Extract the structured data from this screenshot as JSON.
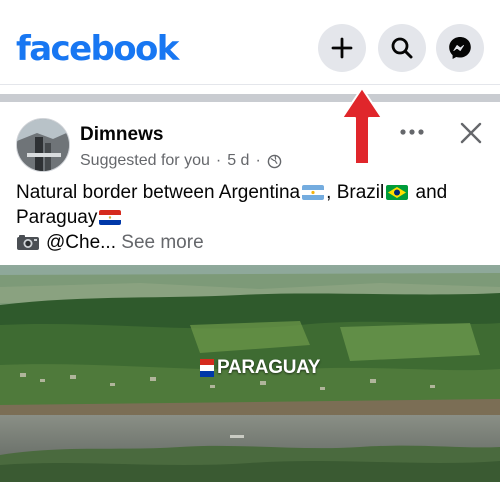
{
  "header": {
    "logo": "facebook",
    "buttons": {
      "create": "plus-icon",
      "search": "search-icon",
      "messenger": "messenger-icon"
    },
    "brand_color": "#1877f2"
  },
  "post": {
    "author": "Dimnews",
    "meta": {
      "suggested": "Suggested for you",
      "separator": "·",
      "time": "5 d",
      "audience_icon": "globe-icon"
    },
    "text": {
      "line1_a": "Natural border between Argentina",
      "line1_b": ", Brazil",
      "line1_c": " and",
      "line2": "Paraguay",
      "line3_prefix": "@Che...",
      "see_more": "See more"
    },
    "image_label": "PARAGUAY"
  },
  "annotation": {
    "arrow_color": "#e0262b"
  }
}
